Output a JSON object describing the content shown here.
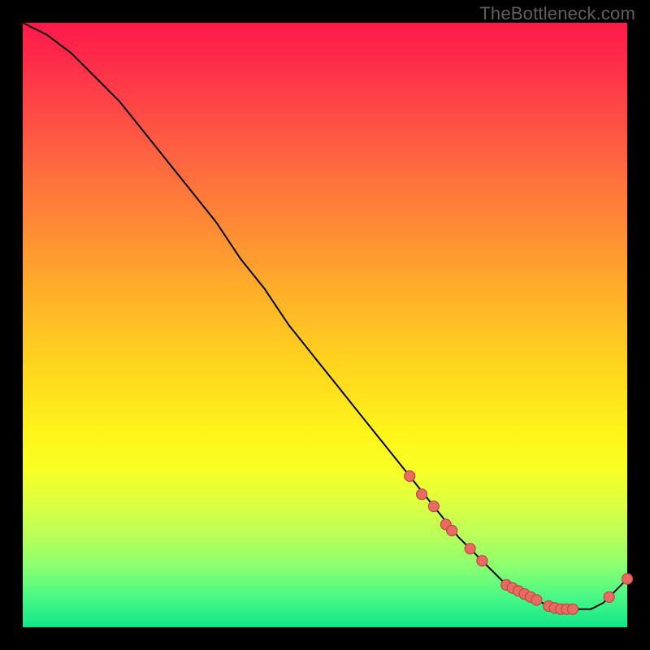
{
  "watermark": "TheBottleneck.com",
  "chart_data": {
    "type": "line",
    "title": "",
    "xlabel": "",
    "ylabel": "",
    "xlim": [
      0,
      100
    ],
    "ylim": [
      0,
      100
    ],
    "grid": false,
    "legend": false,
    "background_gradient": {
      "top": "#ff1a4b",
      "mid": "#ffd21f",
      "bottom": "#12e588"
    },
    "series": [
      {
        "name": "bottleneck-curve",
        "color": "#000000",
        "x": [
          0,
          4,
          8,
          12,
          16,
          20,
          24,
          28,
          32,
          36,
          40,
          44,
          48,
          52,
          56,
          60,
          64,
          68,
          72,
          74,
          76,
          78,
          80,
          82,
          84,
          86,
          88,
          90,
          92,
          94,
          96,
          98,
          100
        ],
        "y": [
          100,
          98,
          95,
          91,
          87,
          82,
          77,
          72,
          67,
          61,
          56,
          50,
          45,
          40,
          35,
          30,
          25,
          20,
          15,
          13,
          11,
          9,
          7,
          6,
          5,
          4,
          3,
          3,
          3,
          3,
          4,
          6,
          8
        ]
      }
    ],
    "markers": {
      "name": "highlight-points",
      "color": "#e96a61",
      "points": [
        {
          "x": 64,
          "y": 25
        },
        {
          "x": 66,
          "y": 22
        },
        {
          "x": 68,
          "y": 20
        },
        {
          "x": 70,
          "y": 17
        },
        {
          "x": 71,
          "y": 16
        },
        {
          "x": 74,
          "y": 13
        },
        {
          "x": 76,
          "y": 11
        },
        {
          "x": 80,
          "y": 7
        },
        {
          "x": 81,
          "y": 6.5
        },
        {
          "x": 82,
          "y": 6
        },
        {
          "x": 83,
          "y": 5.5
        },
        {
          "x": 84,
          "y": 5
        },
        {
          "x": 85,
          "y": 4.5
        },
        {
          "x": 87,
          "y": 3.5
        },
        {
          "x": 88,
          "y": 3.2
        },
        {
          "x": 89,
          "y": 3
        },
        {
          "x": 90,
          "y": 3
        },
        {
          "x": 91,
          "y": 3
        },
        {
          "x": 97,
          "y": 5
        },
        {
          "x": 100,
          "y": 8
        }
      ]
    }
  }
}
